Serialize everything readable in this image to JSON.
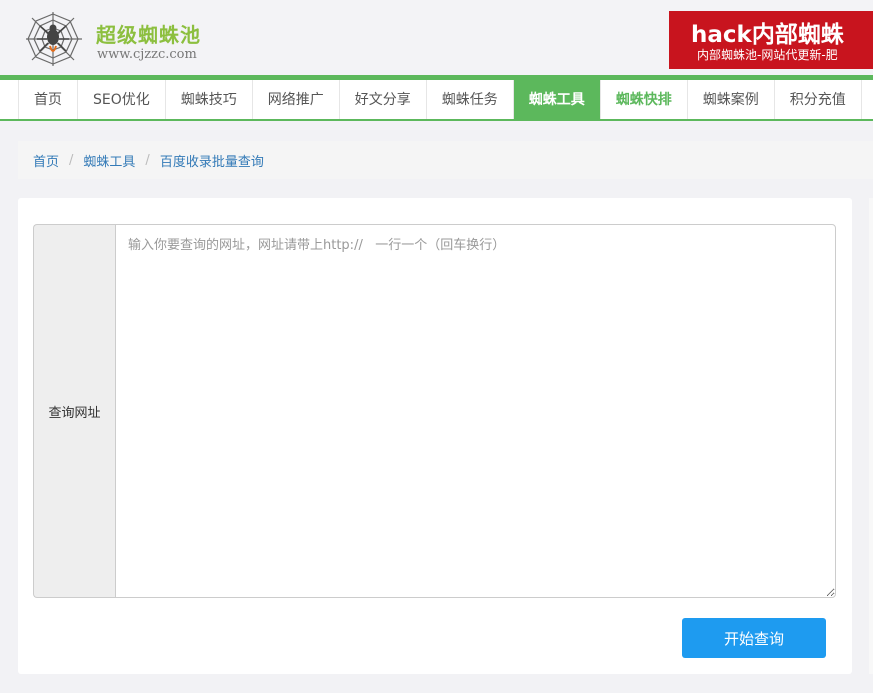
{
  "header": {
    "logo_title": "超级蜘蛛池",
    "logo_url": "www.cjzzc.com",
    "banner_title": "hack内部蜘蛛",
    "banner_subtitle": "内部蜘蛛池-网站代更新-肥"
  },
  "nav": {
    "items": [
      {
        "label": "首页"
      },
      {
        "label": "SEO优化"
      },
      {
        "label": "蜘蛛技巧"
      },
      {
        "label": "网络推广"
      },
      {
        "label": "好文分享"
      },
      {
        "label": "蜘蛛任务"
      },
      {
        "label": "蜘蛛工具",
        "state": "active"
      },
      {
        "label": "蜘蛛快排",
        "state": "highlight"
      },
      {
        "label": "蜘蛛案例"
      },
      {
        "label": "积分充值"
      }
    ]
  },
  "breadcrumb": {
    "items": [
      "首页",
      "蜘蛛工具",
      "百度收录批量查询"
    ],
    "separator": "/"
  },
  "form": {
    "label": "查询网址",
    "value": "",
    "placeholder": "输入你要查询的网址，网址请带上http://   一行一个（回车换行）",
    "submit_label": "开始查询"
  },
  "colors": {
    "brand_green": "#5cb85c",
    "logo_green": "#8cbf3f",
    "button_blue": "#1e9bf0",
    "banner_red": "#c8141e"
  },
  "icons": {
    "logo": "spider-web-icon"
  }
}
